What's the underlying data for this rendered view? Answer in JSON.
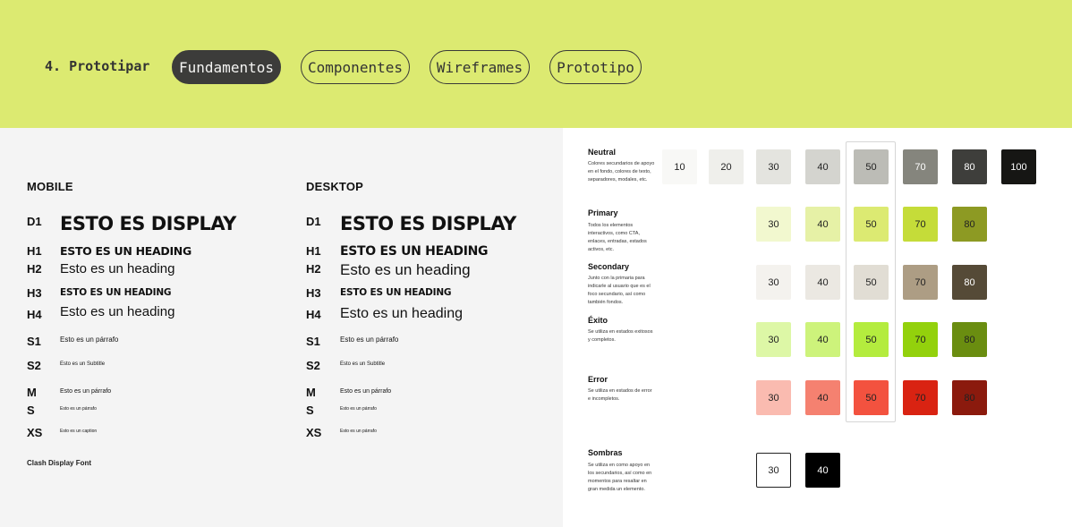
{
  "nav": {
    "step": "4. Prototipar",
    "tabs": [
      {
        "label": "Fundamentos",
        "active": true
      },
      {
        "label": "Componentes",
        "active": false
      },
      {
        "label": "Wireframes",
        "active": false
      },
      {
        "label": "Prototipo",
        "active": false
      }
    ]
  },
  "typography": {
    "mobile_title": "MOBILE",
    "desktop_title": "DESKTOP",
    "tags": [
      "D1",
      "H1",
      "H2",
      "H3",
      "H4",
      "S1",
      "S2",
      "M",
      "S",
      "XS"
    ],
    "samples": {
      "display": "ESTO ES DISPLAY",
      "h1": "ESTO ES UN HEADING",
      "h2": "Esto es un heading",
      "h3": "ESTO ES UN HEADING",
      "h4": "Esto es un heading",
      "s1": "Esto es un párrafo",
      "s2": "Esto es un Subtitle",
      "m": "Esto es un párrafo",
      "s": "Esto es un párrafo",
      "xs": "Esto es un caption",
      "xs_desktop": "Esto es un párrafo"
    },
    "font_note": "Clash Display Font"
  },
  "palette": {
    "groups": [
      {
        "title": "Neutral",
        "desc": "Colores secundarios de apoyo en el fondo, colores de texto, separadores, modales, etc.",
        "swatches": [
          {
            "label": "10",
            "color": "#f8f8f6",
            "text": "#222222"
          },
          {
            "label": "20",
            "color": "#efefeb",
            "text": "#222222"
          },
          {
            "label": "30",
            "color": "#e4e4df",
            "text": "#222222"
          },
          {
            "label": "40",
            "color": "#d4d4cf",
            "text": "#222222"
          },
          {
            "label": "50",
            "color": "#bcbcb6",
            "text": "#222222"
          },
          {
            "label": "70",
            "color": "#85857d",
            "text": "#ffffff"
          },
          {
            "label": "80",
            "color": "#3e3e3b",
            "text": "#ffffff"
          },
          {
            "label": "100",
            "color": "#161614",
            "text": "#ffffff"
          }
        ]
      },
      {
        "title": "Primary",
        "desc": "Todos los elementos interactivos, como CTA, enlaces, entradas, estados activos, etc.",
        "swatches": [
          {
            "label": "30",
            "color": "#f2f8cf",
            "text": "#222222"
          },
          {
            "label": "40",
            "color": "#e6f1a6",
            "text": "#222222"
          },
          {
            "label": "50",
            "color": "#dcea72",
            "text": "#222222"
          },
          {
            "label": "70",
            "color": "#c5dc39",
            "text": "#222222"
          },
          {
            "label": "80",
            "color": "#8d9a23",
            "text": "#222222"
          }
        ]
      },
      {
        "title": "Secondary",
        "desc": "Junto con la primaria para indicarle al usuario que es el foco secundario, así como también fondos.",
        "swatches": [
          {
            "label": "30",
            "color": "#f4f2ee",
            "text": "#222222"
          },
          {
            "label": "40",
            "color": "#ebe8e2",
            "text": "#222222"
          },
          {
            "label": "50",
            "color": "#e1ddd4",
            "text": "#222222"
          },
          {
            "label": "70",
            "color": "#ad9d84",
            "text": "#222222"
          },
          {
            "label": "80",
            "color": "#554a37",
            "text": "#ffffff"
          }
        ]
      },
      {
        "title": "Éxito",
        "desc": "Se utiliza en estados exitosos y completos.",
        "swatches": [
          {
            "label": "30",
            "color": "#ddf7a6",
            "text": "#222222"
          },
          {
            "label": "40",
            "color": "#cdf37b",
            "text": "#222222"
          },
          {
            "label": "50",
            "color": "#b4ec3e",
            "text": "#222222"
          },
          {
            "label": "70",
            "color": "#93d10c",
            "text": "#222222"
          },
          {
            "label": "80",
            "color": "#6a8d10",
            "text": "#222222"
          }
        ]
      },
      {
        "title": "Error",
        "desc": "Se utiliza en estados de error e incompletos.",
        "swatches": [
          {
            "label": "30",
            "color": "#fabbb0",
            "text": "#222222"
          },
          {
            "label": "40",
            "color": "#f58170",
            "text": "#222222"
          },
          {
            "label": "50",
            "color": "#f3523f",
            "text": "#222222"
          },
          {
            "label": "70",
            "color": "#d92312",
            "text": "#222222"
          },
          {
            "label": "80",
            "color": "#8b1a0d",
            "text": "#222222"
          }
        ]
      },
      {
        "title": "Sombras",
        "desc": "Se utiliza en como apoyo en los secundarios, así como en momentos para resaltar en gran medida un elemento.",
        "swatches": [
          {
            "label": "30",
            "color": "#ffffff",
            "text": "#222222"
          },
          {
            "label": "40",
            "color": "#000000",
            "text": "#ffffff"
          }
        ]
      }
    ]
  }
}
